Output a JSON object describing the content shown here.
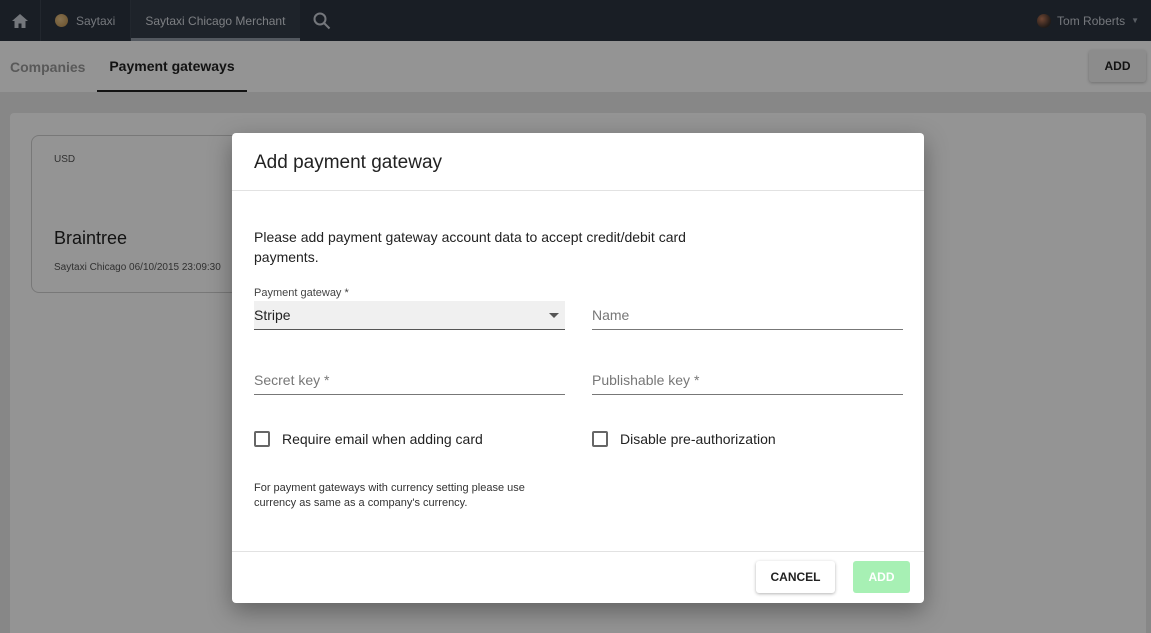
{
  "topbar": {
    "home_icon": "home-icon",
    "app_name": "Saytaxi",
    "merchant_tab": "Saytaxi Chicago Merchant",
    "search_icon": "search-icon",
    "user_name": "Tom Roberts"
  },
  "subheader": {
    "tabs": [
      {
        "label": "Companies",
        "active": false
      },
      {
        "label": "Payment gateways",
        "active": true
      }
    ],
    "add_label": "ADD"
  },
  "card": {
    "currency": "USD",
    "name": "Braintree",
    "meta": "Saytaxi Chicago 06/10/2015 23:09:30"
  },
  "dialog": {
    "title": "Add payment gateway",
    "description": "Please add payment gateway account data to accept credit/debit card payments.",
    "gateway_label": "Payment gateway *",
    "gateway_value": "Stripe",
    "name_placeholder": "Name",
    "secret_key_placeholder": "Secret key *",
    "publishable_key_placeholder": "Publishable key *",
    "require_email_label": "Require email when adding card",
    "require_email_checked": false,
    "disable_preauth_label": "Disable pre-authorization",
    "disable_preauth_checked": false,
    "note": "For payment gateways with currency setting please use currency as same as a company's currency.",
    "cancel_label": "CANCEL",
    "add_label": "ADD"
  },
  "colors": {
    "topbar": "#2c3440",
    "add_button_disabled": "#a7f0b4",
    "overlay": "rgba(0,0,0,0.42)"
  }
}
